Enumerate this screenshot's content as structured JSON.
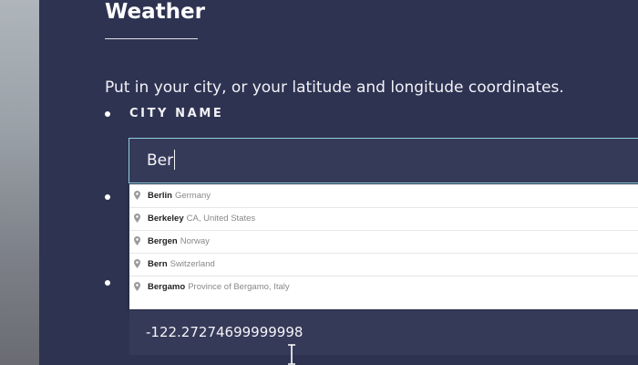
{
  "page": {
    "title": "Weather",
    "intro": "Put in your city, or your latitude and longitude coordinates."
  },
  "city": {
    "label": "CITY NAME",
    "value": "Ber"
  },
  "autocomplete": {
    "items": [
      {
        "main": "Berlin",
        "secondary": "Germany"
      },
      {
        "main": "Berkeley",
        "secondary": "CA, United States"
      },
      {
        "main": "Bergen",
        "secondary": "Norway"
      },
      {
        "main": "Bern",
        "secondary": "Switzerland"
      },
      {
        "main": "Bergamo",
        "secondary": "Province of Bergamo, Italy"
      }
    ],
    "pin_icon": "map-pin-icon"
  },
  "longitude": {
    "value": "-122.27274699999998"
  },
  "colors": {
    "background": "#2f3352",
    "input_background": "#363a59",
    "focus_border": "#8fd0dd",
    "text": "#ffffff"
  }
}
